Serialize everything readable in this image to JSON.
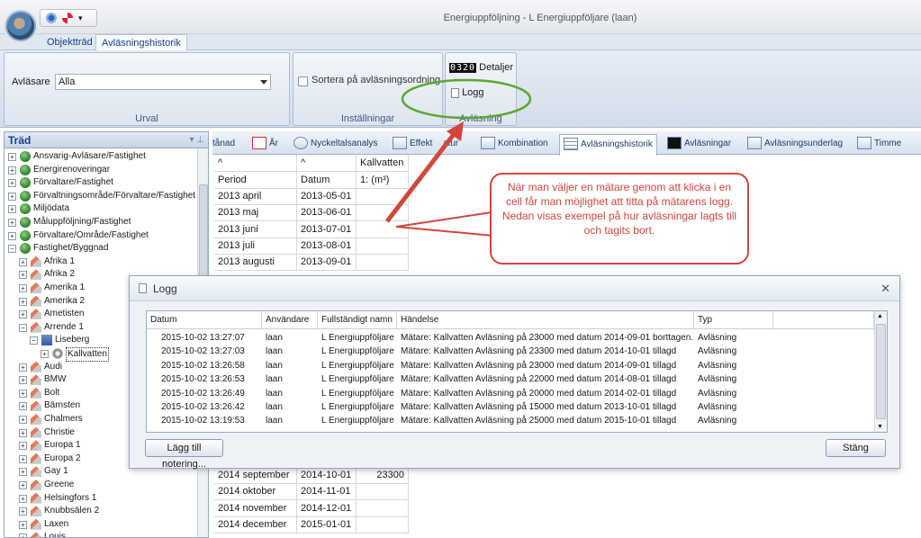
{
  "window": {
    "title": "Energiuppföljning - L Energiuppföljare (laan)"
  },
  "ribbon_tabs": [
    {
      "label": "Objektträd"
    },
    {
      "label": "Avläsningshistorik"
    }
  ],
  "ribbon": {
    "urval": {
      "reader_label": "Avläsare",
      "reader_value": "Alla",
      "group_label": "Urval"
    },
    "installningar": {
      "sort_label": "Sortera på avläsningsordning",
      "group_label": "Inställningar"
    },
    "avlasning": {
      "detaljer_label": "Detaljer",
      "logg_label": "Logg",
      "group_label": "Avläsning",
      "counter_digits": "0320"
    }
  },
  "tree": {
    "title": "Träd",
    "items": [
      "Ansvarig-Avläsare/Fastighet",
      "Energirenoveringar",
      "Förvaltare/Fastighet",
      "Förvaltningsområde/Förvaltare/Fastighet",
      "Miljödata",
      "Målupp­följning/Fastighet",
      "Förvaltare/Område/Fastighet",
      "Fastighet/Byggnad",
      "Afrika 1",
      "Afrika 2",
      "Amerika 1",
      "Amerika 2",
      "Ametisten",
      "Arrende 1",
      "Liseberg",
      "Kallvatten",
      "Audi",
      "BMW",
      "Bolt",
      "Bärnsten",
      "Chalmers",
      "Christie",
      "Europa 1",
      "Europa 2",
      "Gay 1",
      "Greene",
      "Helsingfors 1",
      "Knubbsälen 2",
      "Laxen",
      "Louis"
    ]
  },
  "view_tabs": [
    {
      "label": "tånad"
    },
    {
      "label": "År"
    },
    {
      "label": "Nyckeltalsanalys"
    },
    {
      "label": "Effekt"
    },
    {
      "label": "atur"
    },
    {
      "label": "Kombination"
    },
    {
      "label": "Avläsningshistorik"
    },
    {
      "label": "Avläsningar"
    },
    {
      "label": "Avläsningsunderlag"
    },
    {
      "label": "Timme"
    }
  ],
  "grid": {
    "header_top": {
      "col3": "Kallvatten"
    },
    "headers": {
      "period": "Period",
      "datum": "Datum",
      "unit": "1: (m³)"
    },
    "rows_top": [
      {
        "period": "2013 april",
        "datum": "2013-05-01",
        "value": ""
      },
      {
        "period": "2013 maj",
        "datum": "2013-06-01",
        "value": ""
      },
      {
        "period": "2013 juni",
        "datum": "2013-07-01",
        "value": ""
      },
      {
        "period": "2013 juli",
        "datum": "2013-08-01",
        "value": ""
      },
      {
        "period": "2013 augusti",
        "datum": "2013-09-01",
        "value": ""
      }
    ],
    "rows_bottom": [
      {
        "period": "2014 september",
        "datum": "2014-10-01",
        "value": "23300"
      },
      {
        "period": "2014 oktober",
        "datum": "2014-11-01",
        "value": ""
      },
      {
        "period": "2014 november",
        "datum": "2014-12-01",
        "value": ""
      },
      {
        "period": "2014 december",
        "datum": "2015-01-01",
        "value": ""
      }
    ]
  },
  "callout": {
    "text": "När man väljer en mätare genom att klicka i en cell får man möjlighet att titta på mätarens logg. Nedan visas exempel på hur avläsningar lagts till och tagits bort."
  },
  "log_dialog": {
    "title": "Logg",
    "columns": {
      "datum": "Datum",
      "anvandare": "Användare",
      "namn": "Fullständigt namn",
      "handelse": "Händelse",
      "typ": "Typ"
    },
    "rows": [
      {
        "datum": "2015-10-02 13:27:07",
        "anvandare": "laan",
        "namn": "L Energiuppföljare",
        "handelse": "Mätare: Kallvatten Avläsning på 23000 med datum 2014-09-01 borttagen.",
        "typ": "Avläsning"
      },
      {
        "datum": "2015-10-02 13:27:03",
        "anvandare": "laan",
        "namn": "L Energiuppföljare",
        "handelse": "Mätare: Kallvatten Avläsning på 23300 med datum 2014-10-01 tillagd",
        "typ": "Avläsning"
      },
      {
        "datum": "2015-10-02 13:26:58",
        "anvandare": "laan",
        "namn": "L Energiuppföljare",
        "handelse": "Mätare: Kallvatten Avläsning på 23000 med datum 2014-09-01 tillagd",
        "typ": "Avläsning"
      },
      {
        "datum": "2015-10-02 13:26:53",
        "anvandare": "laan",
        "namn": "L Energiuppföljare",
        "handelse": "Mätare: Kallvatten Avläsning på 22000 med datum 2014-08-01 tillagd",
        "typ": "Avläsning"
      },
      {
        "datum": "2015-10-02 13:26:49",
        "anvandare": "laan",
        "namn": "L Energiuppföljare",
        "handelse": "Mätare: Kallvatten Avläsning på 20000 med datum 2014-02-01 tillagd",
        "typ": "Avläsning"
      },
      {
        "datum": "2015-10-02 13:26:42",
        "anvandare": "laan",
        "namn": "L Energiuppföljare",
        "handelse": "Mätare: Kallvatten Avläsning på 15000 med datum 2013-10-01 tillagd",
        "typ": "Avläsning"
      },
      {
        "datum": "2015-10-02 13:19:53",
        "anvandare": "laan",
        "namn": "L Energiuppföljare",
        "handelse": "Mätare: Kallvatten Avläsning på 25000 med datum 2015-10-01 tillagd",
        "typ": "Avläsning"
      }
    ],
    "add_note_label": "Lägg till notering...",
    "close_label": "Stäng"
  },
  "colors": {
    "annotation": "#d2463b",
    "highlight_ellipse": "#5aa832",
    "ribbon_text": "#15428b"
  }
}
